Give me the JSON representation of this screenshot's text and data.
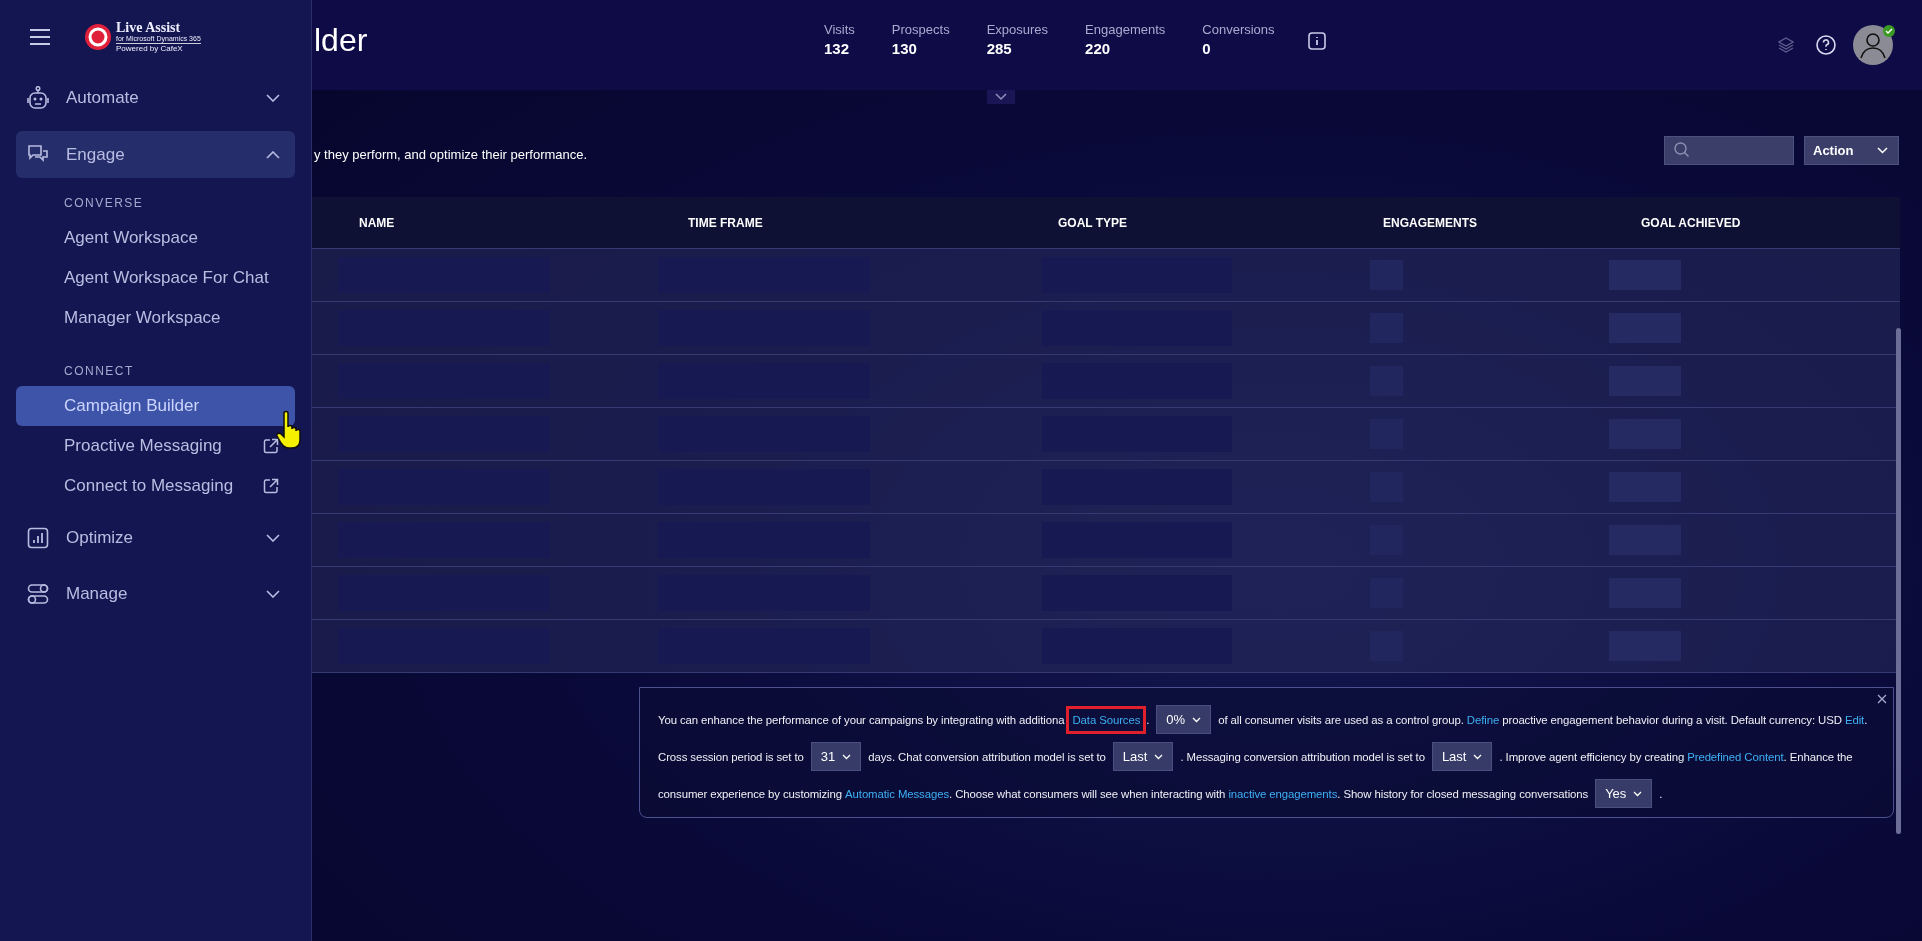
{
  "sidebar": {
    "logo": {
      "title": "Live Assist",
      "subtitle": "for Microsoft Dynamics 365",
      "credit": "Powered by CafeX"
    },
    "groups": [
      {
        "label": "Automate",
        "expanded": false
      },
      {
        "label": "Engage",
        "expanded": true,
        "sections": [
          {
            "heading": "CONVERSE",
            "items": [
              {
                "label": "Agent Workspace",
                "selected": false,
                "external": false
              },
              {
                "label": "Agent Workspace For Chat",
                "selected": false,
                "external": false
              },
              {
                "label": "Manager Workspace",
                "selected": false,
                "external": false
              }
            ]
          },
          {
            "heading": "CONNECT",
            "items": [
              {
                "label": "Campaign Builder",
                "selected": true,
                "external": false
              },
              {
                "label": "Proactive Messaging",
                "selected": false,
                "external": true
              },
              {
                "label": "Connect to Messaging",
                "selected": false,
                "external": true
              }
            ]
          }
        ]
      },
      {
        "label": "Optimize",
        "expanded": false
      },
      {
        "label": "Manage",
        "expanded": false
      }
    ]
  },
  "header": {
    "title": "lder",
    "stats": [
      {
        "label": "Visits",
        "value": "132"
      },
      {
        "label": "Prospects",
        "value": "130"
      },
      {
        "label": "Exposures",
        "value": "285"
      },
      {
        "label": "Engagements",
        "value": "220"
      },
      {
        "label": "Conversions",
        "value": "0"
      }
    ]
  },
  "toolbar": {
    "description": "y they perform, and optimize their performance.",
    "action": "Action"
  },
  "table": {
    "columns": [
      "NAME",
      "TIME FRAME",
      "GOAL TYPE",
      "ENGAGEMENTS",
      "GOAL ACHIEVED"
    ],
    "rows": [
      {
        "loading": true
      },
      {
        "loading": true
      },
      {
        "loading": true
      },
      {
        "loading": true
      },
      {
        "loading": true
      },
      {
        "loading": true
      },
      {
        "loading": true
      },
      {
        "loading": true
      }
    ]
  },
  "info_panel": {
    "lines": [
      [
        {
          "kind": "text",
          "text": "You can enhance the performance of your campaigns by integrating with additiona"
        },
        {
          "kind": "link",
          "text": "Data Sources",
          "highlighted": true
        },
        {
          "kind": "text",
          "text": "."
        },
        {
          "kind": "select",
          "value": "0%"
        },
        {
          "kind": "text",
          "text": "of all consumer visits are used as a control group. "
        },
        {
          "kind": "link",
          "text": "Define",
          "highlighted": false
        },
        {
          "kind": "text",
          "text": " proactive engagement behavior during a visit. Default currency: USD "
        },
        {
          "kind": "link",
          "text": "Edit",
          "highlighted": false
        },
        {
          "kind": "text",
          "text": "."
        }
      ],
      [
        {
          "kind": "text",
          "text": "Cross session period is set to"
        },
        {
          "kind": "select",
          "value": "31"
        },
        {
          "kind": "text",
          "text": "days. Chat conversion attribution model is set to"
        },
        {
          "kind": "select",
          "value": "Last"
        },
        {
          "kind": "text",
          "text": ". Messaging conversion attribution model is set to"
        },
        {
          "kind": "select",
          "value": "Last"
        },
        {
          "kind": "text",
          "text": ". Improve agent efficiency by creating "
        },
        {
          "kind": "link",
          "text": "Predefined Content",
          "highlighted": false
        },
        {
          "kind": "text",
          "text": ". Enhance the"
        }
      ],
      [
        {
          "kind": "text",
          "text": "consumer experience by customizing "
        },
        {
          "kind": "link",
          "text": "Automatic Messages",
          "highlighted": false
        },
        {
          "kind": "text",
          "text": ". Choose what consumers will see when interacting with "
        },
        {
          "kind": "link",
          "text": "inactive engagements",
          "highlighted": false
        },
        {
          "kind": "text",
          "text": ". Show history for closed messaging conversations"
        },
        {
          "kind": "select",
          "value": "Yes"
        },
        {
          "kind": "text",
          "text": "."
        }
      ]
    ]
  }
}
